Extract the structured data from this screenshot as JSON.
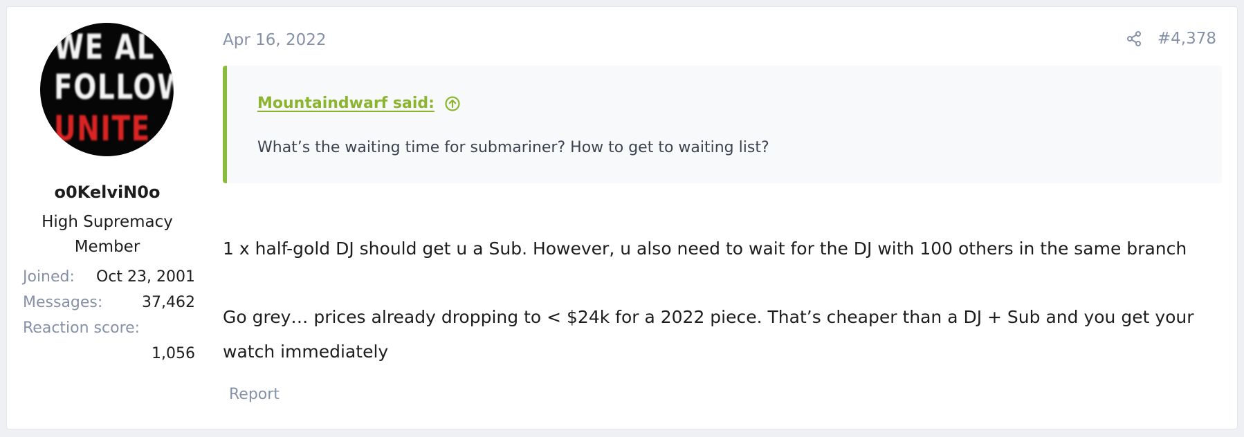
{
  "post": {
    "avatar": {
      "line1": "WE AL",
      "line2": "FOLLOW",
      "line3": "UNITE",
      "colors": {
        "background": "#060606",
        "text": "#f4f4f4",
        "accent": "#d92424"
      }
    },
    "author": {
      "username": "o0KelviN0o",
      "title_line1": "High Supremacy",
      "title_line2": "Member",
      "stats": [
        {
          "label": "Joined:",
          "value": "Oct 23, 2001"
        },
        {
          "label": "Messages:",
          "value": "37,462"
        },
        {
          "label": "Reaction score:",
          "value": "1,056"
        }
      ]
    },
    "date": "Apr 16, 2022",
    "share_icon": "share-icon",
    "number": "#4,378",
    "quote": {
      "author": "Mountaindwarf said:",
      "jump_icon": "arrow-circle-up-icon",
      "text": "What’s the waiting time for submariner? How to get to waiting list?",
      "accent_color": "#8bbb3a"
    },
    "message": {
      "paragraphs": [
        "1 x half-gold DJ should get u a Sub. However, u also need to wait for the DJ with 100 others in the same branch",
        "Go grey… prices already dropping to < $24k for a 2022 piece. That’s cheaper than a DJ + Sub and you get your watch immediately"
      ]
    },
    "actions": {
      "report_label": "Report"
    }
  }
}
